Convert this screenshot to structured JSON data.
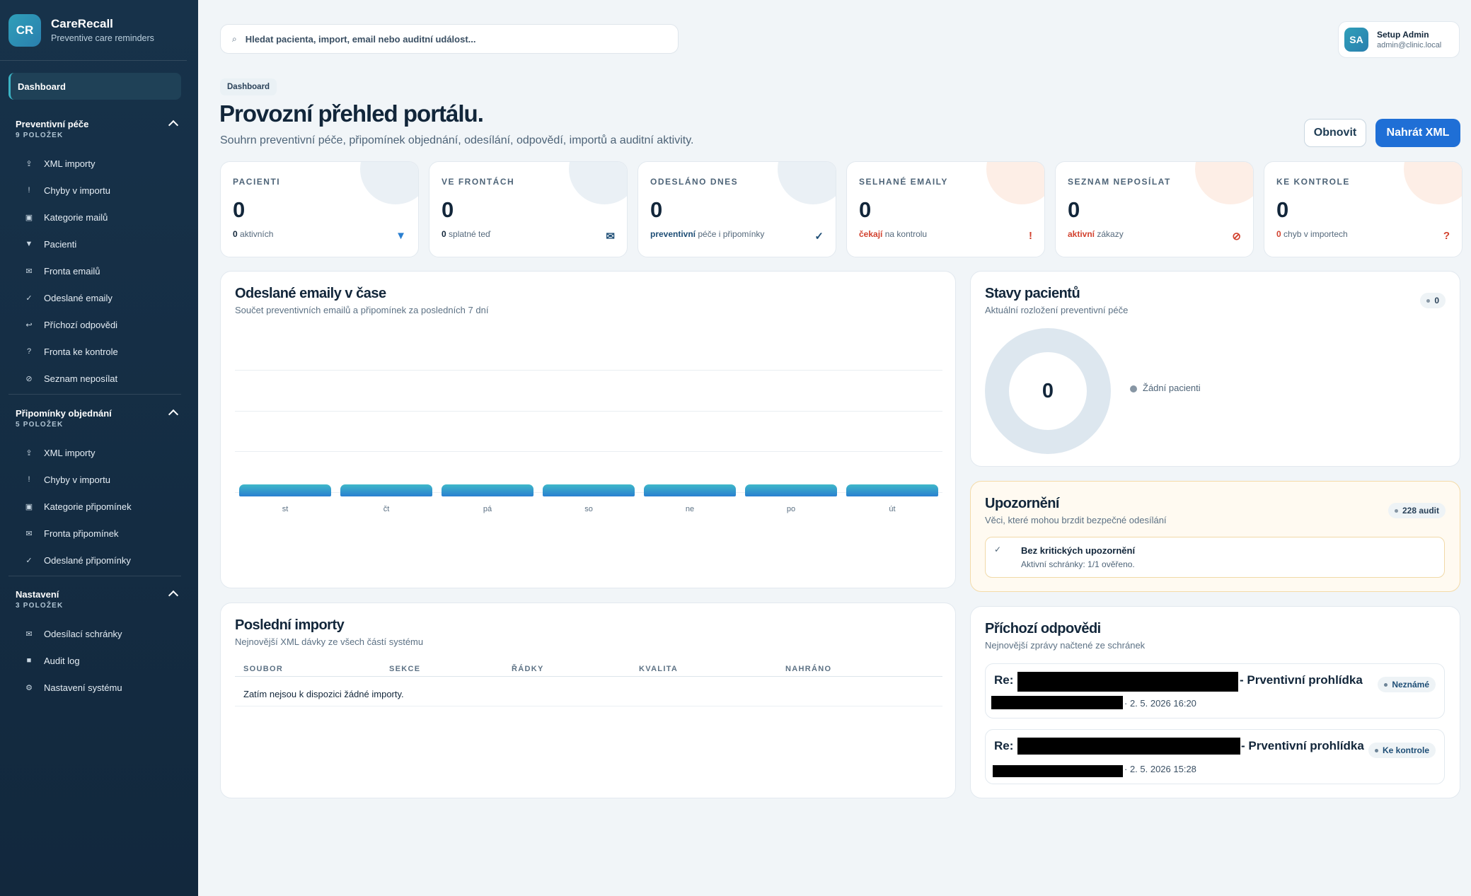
{
  "brand": {
    "logo": "CR",
    "name": "CareRecall",
    "subtitle": "Preventive care reminders"
  },
  "sidebar": {
    "dashboard": "Dashboard",
    "groups": [
      {
        "title": "Preventivní péče",
        "count": "9 POLOŽEK",
        "items": [
          {
            "icon": "upload-icon",
            "glyph": "⇪",
            "label": "XML importy"
          },
          {
            "icon": "exclamation-icon",
            "glyph": "!",
            "label": "Chyby v importu"
          },
          {
            "icon": "category-icon",
            "glyph": "▣",
            "label": "Kategorie mailů"
          },
          {
            "icon": "patients-icon",
            "glyph": "▼",
            "label": "Pacienti"
          },
          {
            "icon": "mail-icon",
            "glyph": "✉",
            "label": "Fronta emailů"
          },
          {
            "icon": "check-icon",
            "glyph": "✓",
            "label": "Odeslané emaily"
          },
          {
            "icon": "reply-icon",
            "glyph": "↩",
            "label": "Příchozí odpovědi"
          },
          {
            "icon": "question-icon",
            "glyph": "?",
            "label": "Fronta ke kontrole"
          },
          {
            "icon": "block-icon",
            "glyph": "⊘",
            "label": "Seznam neposílat"
          }
        ]
      },
      {
        "title": "Připomínky objednání",
        "count": "5 POLOŽEK",
        "items": [
          {
            "icon": "upload-icon",
            "glyph": "⇪",
            "label": "XML importy"
          },
          {
            "icon": "exclamation-icon",
            "glyph": "!",
            "label": "Chyby v importu"
          },
          {
            "icon": "category-icon",
            "glyph": "▣",
            "label": "Kategorie připomínek"
          },
          {
            "icon": "mail-icon",
            "glyph": "✉",
            "label": "Fronta připomínek"
          },
          {
            "icon": "check-icon",
            "glyph": "✓",
            "label": "Odeslané připomínky"
          }
        ]
      },
      {
        "title": "Nastavení",
        "count": "3 POLOŽEK",
        "items": [
          {
            "icon": "mailbox-icon",
            "glyph": "✉",
            "label": "Odesílací schránky"
          },
          {
            "icon": "log-icon",
            "glyph": "■",
            "label": "Audit log"
          },
          {
            "icon": "settings-icon",
            "glyph": "⚙",
            "label": "Nastavení systému"
          }
        ]
      }
    ]
  },
  "search": {
    "placeholder": "Hledat pacienta, import, email nebo auditní událost..."
  },
  "user": {
    "initials": "SA",
    "name": "Setup Admin",
    "email": "admin@clinic.local"
  },
  "header": {
    "breadcrumb": "Dashboard",
    "title": "Provozní přehled portálu.",
    "subtitle": "Souhrn preventivní péče, připomínek objednání, odesílání, odpovědí, importů a auditní aktivity.",
    "refresh_label": "Obnovit",
    "upload_label": "Nahrát XML"
  },
  "stats": [
    {
      "label": "PACIENTI",
      "value": "0",
      "note_strong": "0",
      "note": " aktivních",
      "icon": "patients-icon",
      "glyph": "▼",
      "color": "#2a7fd0"
    },
    {
      "label": "VE FRONTÁCH",
      "value": "0",
      "note_strong": "0",
      "note": " splatné teď",
      "icon": "mail-icon",
      "glyph": "✉",
      "color": "#1e4e76"
    },
    {
      "label": "ODESLÁNO DNES",
      "value": "0",
      "note_strong": "preventivní",
      "note": " péče i připomínky",
      "icon": "check-icon",
      "glyph": "✓",
      "color": "#1e4e76"
    },
    {
      "label": "SELHANÉ EMAILY",
      "value": "0",
      "note_strong": "čekají",
      "note": " na kontrolu",
      "icon": "exclamation-icon",
      "glyph": "!",
      "color": "#d2422f"
    },
    {
      "label": "SEZNAM NEPOSÍLAT",
      "value": "0",
      "note_strong": "aktivní",
      "note": " zákazy",
      "icon": "block-icon",
      "glyph": "⊘",
      "color": "#d2422f"
    },
    {
      "label": "KE KONTROLE",
      "value": "0",
      "note_strong": "0",
      "note": " chyb v importech",
      "icon": "question-icon",
      "glyph": "?",
      "color": "#d2422f"
    }
  ],
  "emails_chart": {
    "title": "Odeslané emaily v čase",
    "subtitle": "Součet preventivních emailů a připomínek za posledních 7 dní"
  },
  "chart_data": {
    "type": "bar",
    "categories": [
      "st",
      "čt",
      "pá",
      "so",
      "ne",
      "po",
      "út"
    ],
    "values": [
      0,
      0,
      0,
      0,
      0,
      0,
      0
    ],
    "title": "Odeslané emaily v čase",
    "xlabel": "",
    "ylabel": "",
    "grid": true
  },
  "patient_states": {
    "title": "Stavy pacientů",
    "subtitle": "Aktuální rozložení preventivní péče",
    "badge": "0",
    "total": "0",
    "legend": "Žádní pacienti"
  },
  "warnings": {
    "title": "Upozornění",
    "subtitle": "Věci, které mohou brzdit bezpečné odesílání",
    "badge": "228 audit",
    "item_title": "Bez kritických upozornění",
    "item_sub": "Aktivní schránky: 1/1 ověřeno.",
    "item_icon": "✓"
  },
  "imports": {
    "title": "Poslední importy",
    "subtitle": "Nejnovější XML dávky ze všech částí systému",
    "columns": [
      "SOUBOR",
      "SEKCE",
      "ŘÁDKY",
      "KVALITA",
      "NAHRÁNO"
    ],
    "empty": "Zatím nejsou k dispozici žádné importy."
  },
  "replies": {
    "title": "Příchozí odpovědi",
    "subtitle": "Nejnovější zprávy načtené ze schránek",
    "items": [
      {
        "prefix": "Re:",
        "subject": "- Prventivní prohlídka",
        "date": "· 2. 5. 2026 16:20",
        "status": "Neznámé"
      },
      {
        "prefix": "Re:",
        "subject": "- Prventivní prohlídka",
        "date": "· 2. 5. 2026 15:28",
        "status": "Ke kontrole"
      }
    ]
  }
}
